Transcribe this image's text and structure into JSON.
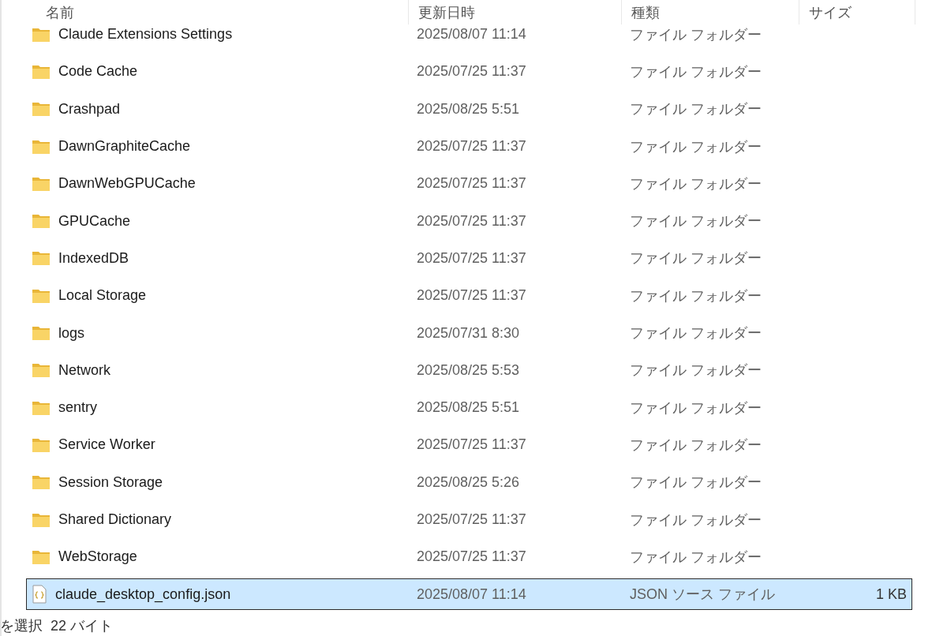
{
  "columns": [
    "名前",
    "更新日時",
    "種類",
    "サイズ"
  ],
  "rows": [
    {
      "kind": "folder",
      "name": "Claude Extensions Settings",
      "modified": "2025/08/07 11:14",
      "type": "ファイル フォルダー",
      "selected": false
    },
    {
      "kind": "folder",
      "name": "Code Cache",
      "modified": "2025/07/25 11:37",
      "type": "ファイル フォルダー",
      "selected": false
    },
    {
      "kind": "folder",
      "name": "Crashpad",
      "modified": "2025/08/25 5:51",
      "type": "ファイル フォルダー",
      "selected": false
    },
    {
      "kind": "folder",
      "name": "DawnGraphiteCache",
      "modified": "2025/07/25 11:37",
      "type": "ファイル フォルダー",
      "selected": false
    },
    {
      "kind": "folder",
      "name": "DawnWebGPUCache",
      "modified": "2025/07/25 11:37",
      "type": "ファイル フォルダー",
      "selected": false
    },
    {
      "kind": "folder",
      "name": "GPUCache",
      "modified": "2025/07/25 11:37",
      "type": "ファイル フォルダー",
      "selected": false
    },
    {
      "kind": "folder",
      "name": "IndexedDB",
      "modified": "2025/07/25 11:37",
      "type": "ファイル フォルダー",
      "selected": false
    },
    {
      "kind": "folder",
      "name": "Local Storage",
      "modified": "2025/07/25 11:37",
      "type": "ファイル フォルダー",
      "selected": false
    },
    {
      "kind": "folder",
      "name": "logs",
      "modified": "2025/07/31 8:30",
      "type": "ファイル フォルダー",
      "selected": false
    },
    {
      "kind": "folder",
      "name": "Network",
      "modified": "2025/08/25 5:53",
      "type": "ファイル フォルダー",
      "selected": false
    },
    {
      "kind": "folder",
      "name": "sentry",
      "modified": "2025/08/25 5:51",
      "type": "ファイル フォルダー",
      "selected": false
    },
    {
      "kind": "folder",
      "name": "Service Worker",
      "modified": "2025/07/25 11:37",
      "type": "ファイル フォルダー",
      "selected": false
    },
    {
      "kind": "folder",
      "name": "Session Storage",
      "modified": "2025/08/25 5:26",
      "type": "ファイル フォルダー",
      "selected": false
    },
    {
      "kind": "folder",
      "name": "Shared Dictionary",
      "modified": "2025/07/25 11:37",
      "type": "ファイル フォルダー",
      "selected": false
    },
    {
      "kind": "folder",
      "name": "WebStorage",
      "modified": "2025/07/25 11:37",
      "type": "ファイル フォルダー",
      "selected": false
    },
    {
      "kind": "json",
      "name": "claude_desktop_config.json",
      "modified": "2025/08/07 11:14",
      "type": "JSON ソース ファイル",
      "size": "1 KB",
      "selected": true
    }
  ],
  "status_bar": {
    "selection": "を選択",
    "selection_size": "22 バイト"
  }
}
